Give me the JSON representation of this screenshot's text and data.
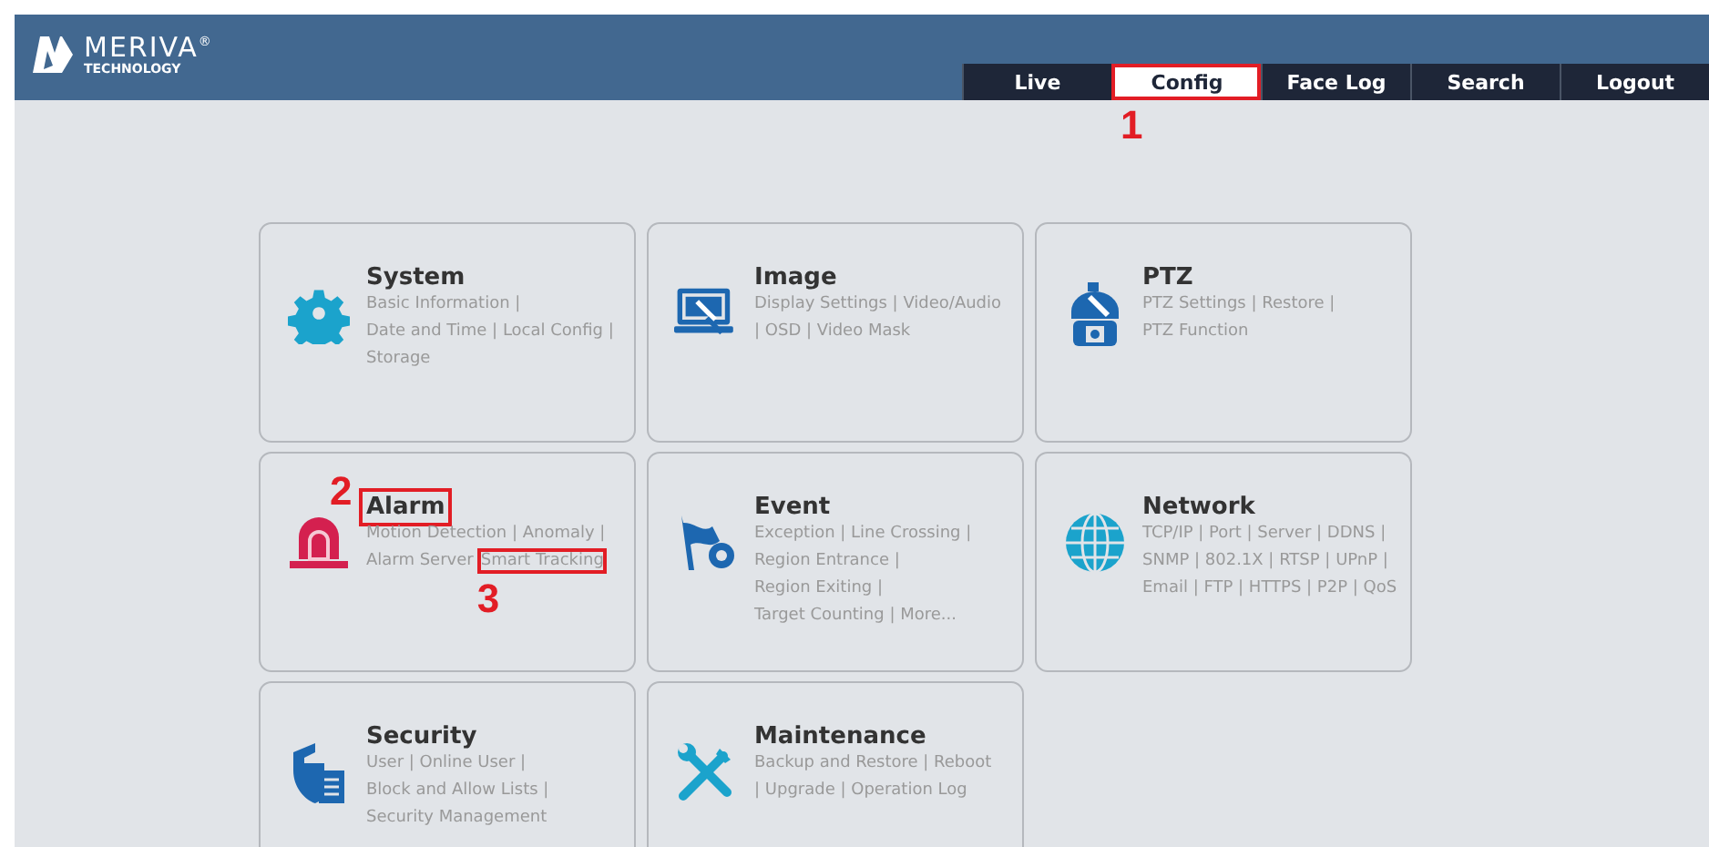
{
  "brand": {
    "name": "MERIVA",
    "mark": "®",
    "tagline": "TECHNOLOGY"
  },
  "tabs": [
    {
      "label": "Live",
      "selected": false
    },
    {
      "label": "Config",
      "selected": true,
      "callout": "1"
    },
    {
      "label": "Face Log",
      "selected": false
    },
    {
      "label": "Search",
      "selected": false
    },
    {
      "label": "Logout",
      "selected": false
    }
  ],
  "cards": [
    {
      "kind": "gear",
      "title": "System",
      "lines": [
        [
          {
            "text": "Basic Information |"
          }
        ],
        [
          {
            "text": "Date and Time | Local Config |"
          }
        ],
        [
          {
            "text": "Storage"
          }
        ]
      ]
    },
    {
      "kind": "monitor",
      "title": "Image",
      "lines": [
        [
          {
            "text": "Display Settings | Video/Audio"
          }
        ],
        [
          {
            "text": "| OSD | Video Mask"
          }
        ]
      ]
    },
    {
      "kind": "ptz",
      "title": "PTZ",
      "lines": [
        [
          {
            "text": "PTZ Settings | Restore |"
          }
        ],
        [
          {
            "text": "PTZ Function"
          }
        ]
      ]
    },
    {
      "kind": "alarm",
      "title": "Alarm",
      "callout": "2",
      "lines": [
        [
          {
            "text": "Motion Detection | Anomaly |"
          }
        ],
        [
          {
            "text": "Alarm Server"
          },
          {
            "text": "Smart Tracking",
            "callout": "3"
          }
        ]
      ]
    },
    {
      "kind": "event",
      "title": "Event",
      "lines": [
        [
          {
            "text": "Exception | Line Crossing |"
          }
        ],
        [
          {
            "text": "Region Entrance |"
          }
        ],
        [
          {
            "text": "Region Exiting |"
          }
        ],
        [
          {
            "text": "Target Counting | More..."
          }
        ]
      ]
    },
    {
      "kind": "globe",
      "title": "Network",
      "lines": [
        [
          {
            "text": "TCP/IP | Port | Server | DDNS |"
          }
        ],
        [
          {
            "text": "SNMP | 802.1X | RTSP | UPnP |"
          }
        ],
        [
          {
            "text": "Email | FTP | HTTPS | P2P | QoS"
          }
        ]
      ]
    },
    {
      "kind": "shield",
      "title": "Security",
      "lines": [
        [
          {
            "text": "User | Online User |"
          }
        ],
        [
          {
            "text": "Block and Allow Lists |"
          }
        ],
        [
          {
            "text": "Security Management"
          }
        ]
      ]
    },
    {
      "kind": "tools",
      "title": "Maintenance",
      "lines": [
        [
          {
            "text": "Backup and Restore | Reboot"
          }
        ],
        [
          {
            "text": "| Upgrade | Operation Log"
          }
        ]
      ]
    }
  ]
}
